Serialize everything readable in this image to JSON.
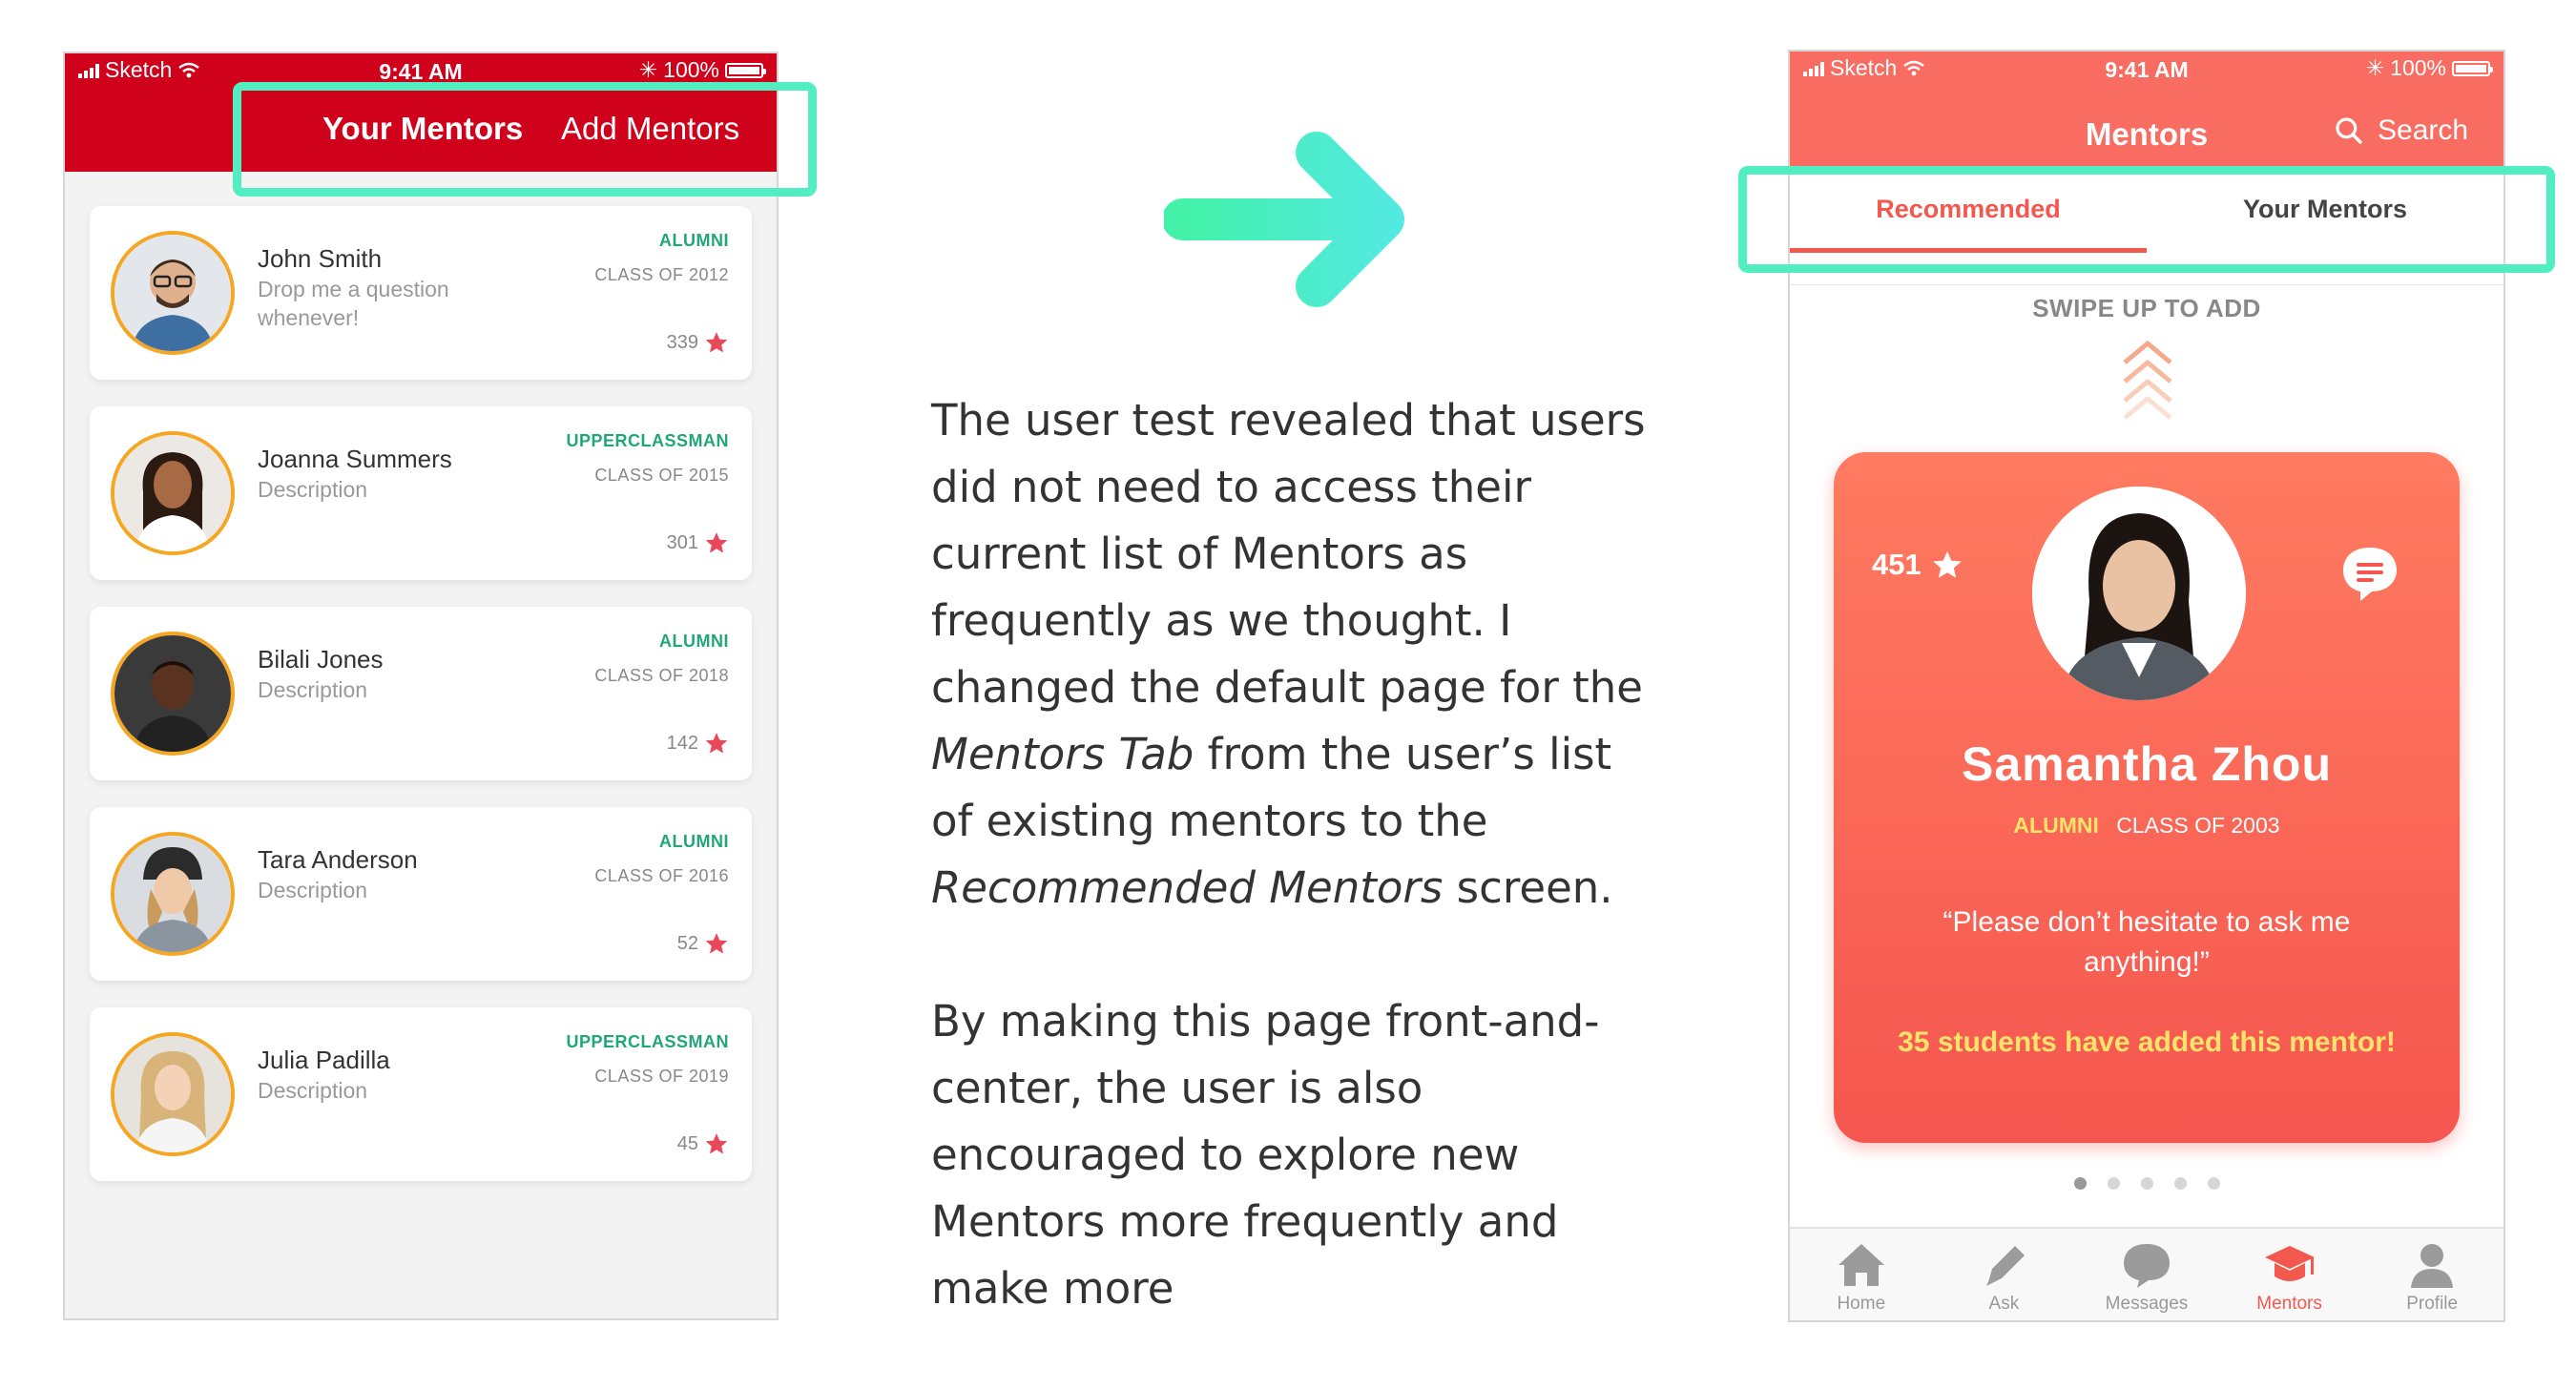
{
  "status": {
    "carrier": "Sketch",
    "time": "9:41 AM",
    "battery": "100%"
  },
  "left": {
    "tabs": {
      "active": "Your Mentors",
      "inactive": "Add Mentors"
    },
    "mentors": [
      {
        "name": "John Smith",
        "desc": "Drop me a question whenever!",
        "tag": "ALUMNI",
        "class": "CLASS OF 2012",
        "rating": "339"
      },
      {
        "name": "Joanna Summers",
        "desc": "Description",
        "tag": "UPPERCLASSMAN",
        "class": "CLASS OF 2015",
        "rating": "301"
      },
      {
        "name": "Bilali Jones",
        "desc": "Description",
        "tag": "ALUMNI",
        "class": "CLASS OF 2018",
        "rating": "142"
      },
      {
        "name": "Tara Anderson",
        "desc": "Description",
        "tag": "ALUMNI",
        "class": "CLASS OF 2016",
        "rating": "52"
      },
      {
        "name": "Julia Padilla",
        "desc": "Description",
        "tag": "UPPERCLASSMAN",
        "class": "CLASS OF 2019",
        "rating": "45"
      }
    ]
  },
  "explain": {
    "p1_a": "The user test revealed that users did not need to access their current list of Mentors as frequently as we thought. I changed the default page for the ",
    "p1_em1": "Mentors Tab",
    "p1_b": " from the user’s list of existing mentors to the ",
    "p1_em2": "Recommended Mentors",
    "p1_c": " screen.",
    "p2": "By making this page front-and-center, the user is also encouraged to  explore new Mentors more frequently and make more"
  },
  "right": {
    "title": "Mentors",
    "search": "Search",
    "segments": {
      "recommended": "Recommended",
      "your": "Your Mentors"
    },
    "swipe": "SWIPE UP TO ADD",
    "card": {
      "rating": "451",
      "name": "Samantha Zhou",
      "tag": "ALUMNI",
      "class": "CLASS OF 2003",
      "quote": "“Please don’t hesitate to ask me anything!”",
      "added": "35 students have added this mentor!"
    },
    "tabs": {
      "home": "Home",
      "ask": "Ask",
      "messages": "Messages",
      "mentors": "Mentors",
      "profile": "Profile"
    }
  },
  "colors": {
    "left_header": "#d0021b",
    "right_header": "#f86c62",
    "highlight": "#53edc2",
    "star": "#e8485a",
    "accent": "#f2584e"
  }
}
